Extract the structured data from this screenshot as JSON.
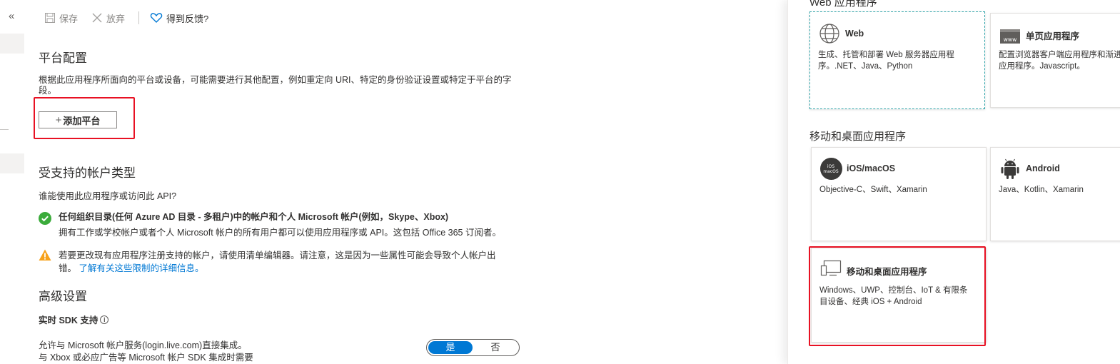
{
  "toolbar": {
    "collapse_glyph": "«",
    "save_label": "保存",
    "discard_label": "放弃",
    "feedback_label": "得到反馈?"
  },
  "platform": {
    "title": "平台配置",
    "description_line1": "根据此应用程序所面向的平台或设备，可能需要进行其他配置，例如重定向 URI、特定的身份验证设置或特定于平台的字",
    "description_line2": "段。",
    "add_button_label": "添加平台",
    "add_button_plus": "+"
  },
  "account_types": {
    "title": "受支持的帐户类型",
    "question": "谁能使用此应用程序或访问此 API?",
    "selected_option": "任何组织目录(任何 Azure AD 目录 - 多租户)中的帐户和个人 Microsoft 帐户(例如，Skype、Xbox)",
    "selected_option_desc": "拥有工作或学校帐户或者个人 Microsoft 帐户的所有用户都可以使用应用程序或 API。这包括 Office 365 订阅者。",
    "warning_line1": "若要更改现有应用程序注册支持的帐户，请使用清单编辑器。请注意，这是因为一些属性可能会导致个人帐户出",
    "warning_line2_prefix": "错。",
    "warning_link": "了解有关这些限制的详细信息。"
  },
  "advanced": {
    "title": "高级设置",
    "sdk_label": "实时 SDK 支持",
    "info_glyph": "i",
    "allow_line1": "允许与 Microsoft 帐户服务(login.live.com)直接集成。",
    "allow_line2": "与 Xbox 或必应广告等 Microsoft 帐户 SDK 集成时需要",
    "toggle_yes": "是",
    "toggle_no": "否",
    "toggle_value": "是"
  },
  "panel": {
    "web_section_title": "Web 应用程序",
    "mobile_section_title": "移动和桌面应用程序",
    "cards": {
      "web": {
        "title": "Web",
        "desc1": "生成、托管和部署 Web 服务器应用程",
        "desc2": "序。.NET、Java、Python",
        "icon": "globe-icon"
      },
      "spa": {
        "title": "单页应用程序",
        "desc1": "配置浏览器客户端应用程序和渐进式 Web",
        "desc2": "应用程序。Javascript。",
        "icon_text": "www",
        "icon": "www-icon"
      },
      "ios": {
        "title": "iOS/macOS",
        "desc1": "Objective-C、Swift、Xamarin",
        "icon_text1": "iOS",
        "icon_text2": "macOS",
        "icon": "apple-icon"
      },
      "android": {
        "title": "Android",
        "desc1": "Java、Kotlin、Xamarin",
        "icon": "android-icon"
      },
      "desktop": {
        "title": "移动和桌面应用程序",
        "desc1": "Windows、UWP、控制台、IoT & 有限条",
        "desc2": "目设备、经典 iOS + Android",
        "icon": "desktop-icon"
      }
    }
  },
  "colors": {
    "accent": "#0078d4",
    "highlight": "#e81123",
    "success": "#107c10",
    "warning": "#ffaa44"
  }
}
